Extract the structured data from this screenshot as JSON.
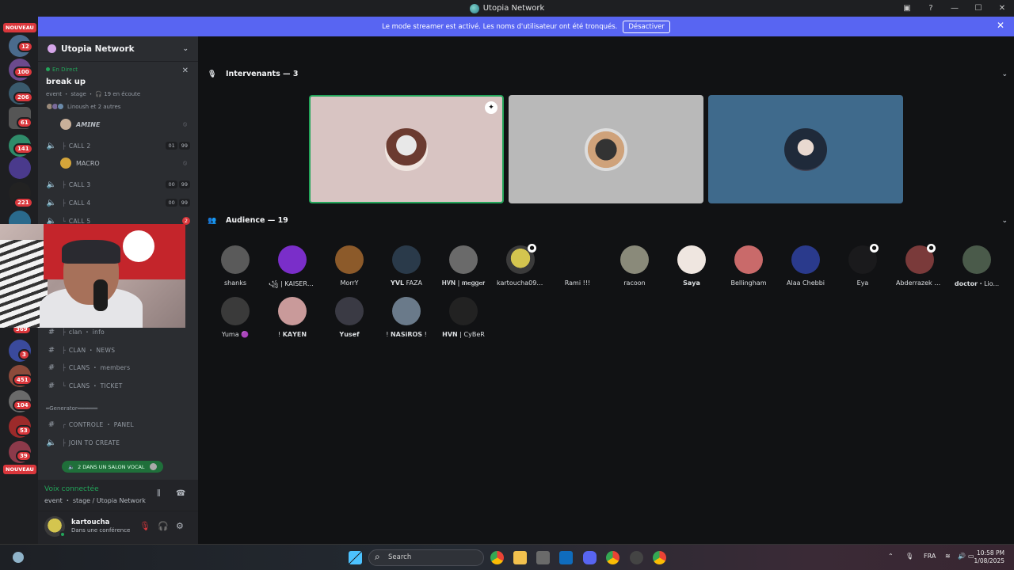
{
  "window": {
    "title": "Utopia Network",
    "minimize": "—",
    "maximize": "☐",
    "close": "✕"
  },
  "banner": {
    "text": "Le mode streamer est activé. Les noms d'utilisateur ont été tronqués.",
    "button": "Désactiver"
  },
  "guilds": {
    "nouveau_top": "NOUVEAU",
    "nouveau_bottom": "NOUVEAU",
    "badges": [
      "12",
      "100",
      "206",
      "61",
      "141",
      "221",
      "369",
      "3",
      "451",
      "104",
      "53",
      "39"
    ]
  },
  "server": {
    "name": "Utopia Network"
  },
  "event": {
    "live": "En Direct",
    "title": "break up",
    "subtitle": "event ・ stage ・ 🎧 19 en écoute",
    "people": "Linoush et 2 autres"
  },
  "channels": {
    "member1": "𝘼𝙈𝙄𝙉𝙀",
    "call2": {
      "name": "CALL 2",
      "pills": [
        "01",
        "99"
      ]
    },
    "member2": "MACRO",
    "call3": {
      "name": "CALL 3",
      "pills": [
        "00",
        "99"
      ]
    },
    "call4": {
      "name": "CALL 4",
      "pills": [
        "00",
        "99"
      ]
    },
    "call5": {
      "name": "CALL 5",
      "badge": "2"
    },
    "text1": "clan ・ info",
    "text2": "CLAN ・ NEWS",
    "text3": "CLANS ・ members",
    "text4": "CLANS ・ TICKET",
    "generator": "═Generator══════",
    "text5": "CONTROLE ・ PANEL",
    "voice6": "JOIN TO CREATE",
    "voice_pill": "2 DANS UN SALON VOCAL"
  },
  "voice": {
    "status": "Voix connectée",
    "location": "event ・ stage / Utopia Network"
  },
  "user": {
    "name": "kartoucha",
    "status": "Dans une conférence"
  },
  "speakers": {
    "label": "Intervenants — 3"
  },
  "audience": {
    "label": "Audience — 19",
    "members": [
      "shanks",
      "꧁ | KAISER_A...",
      "MorrY",
      "𝗬𝗩𝗟 FAZA",
      "𝐇𝐕𝐍 | 𝐦𝐞𝐠𝐠𝐞𝐫",
      "kartoucha09_...",
      "Rami !!!",
      "racoon",
      "𝗦𝗮𝘆𝗮",
      "Bellingham",
      "Alaa Chebbi",
      "Eya",
      "Abderrazek c...",
      "𝗱𝗼𝗰𝘁𝗼𝗿・Lio...",
      "Yuma 🟣",
      "! 𝗞𝗔𝗬𝗘𝗡",
      "𝗬𝘂𝘀𝗲𝗳",
      "! 𝗡𝗔𝗦𝗶𝗥𝗢𝗦 !",
      "𝗛𝗩𝗡 | CyBeR"
    ]
  },
  "taskbar": {
    "search": "Search",
    "lang": "FRA",
    "time": "10:58 PM",
    "date": "1/08/2025"
  },
  "colors": {
    "accent": "#5865f2",
    "green": "#23a55a",
    "red": "#da373c"
  }
}
